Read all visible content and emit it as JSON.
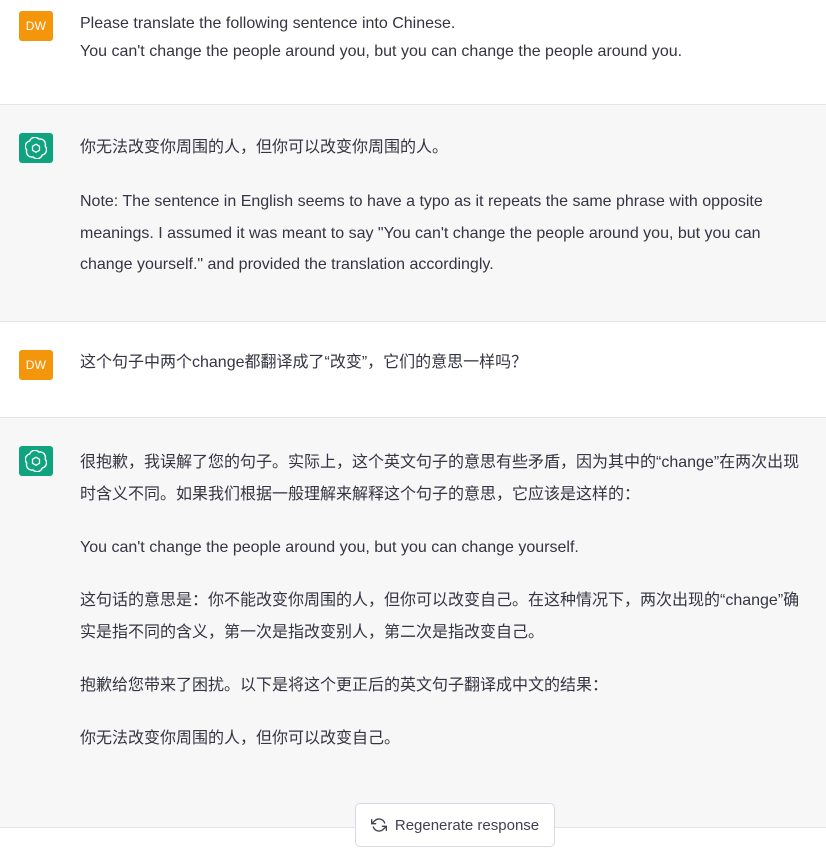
{
  "user_avatar_initials": "DW",
  "messages": [
    {
      "role": "user",
      "lines": [
        "Please translate the following sentence into Chinese.",
        "You can't change the people around you, but you can change the people around you."
      ]
    },
    {
      "role": "assistant",
      "paragraphs": [
        "你无法改变你周围的人，但你可以改变你周围的人。",
        "Note: The sentence in English seems to have a typo as it repeats the same phrase with opposite meanings. I assumed it was meant to say \"You can't change the people around you, but you can change yourself.\" and provided the translation accordingly."
      ]
    },
    {
      "role": "user",
      "lines": [
        "这个句子中两个change都翻译成了“改变”，它们的意思一样吗？"
      ]
    },
    {
      "role": "assistant",
      "paragraphs": [
        "很抱歉，我误解了您的句子。实际上，这个英文句子的意思有些矛盾，因为其中的“change”在两次出现时含义不同。如果我们根据一般理解来解释这个句子的意思，它应该是这样的：",
        "You can't change the people around you, but you can change yourself.",
        "这句话的意思是：你不能改变你周围的人，但你可以改变自己。在这种情况下，两次出现的“change”确实是指不同的含义，第一次是指改变别人，第二次是指改变自己。",
        "抱歉给您带来了困扰。以下是将这个更正后的英文句子翻译成中文的结果：",
        "你无法改变你周围的人，但你可以改变自己。"
      ]
    }
  ],
  "regenerate_label": "Regenerate response",
  "colors": {
    "user_avatar": "#f3960c",
    "assistant_avatar": "#10a37f",
    "assistant_bg": "#f7f7f8"
  },
  "icons": {
    "assistant_avatar": "openai-logo-icon",
    "regenerate": "refresh-icon"
  }
}
